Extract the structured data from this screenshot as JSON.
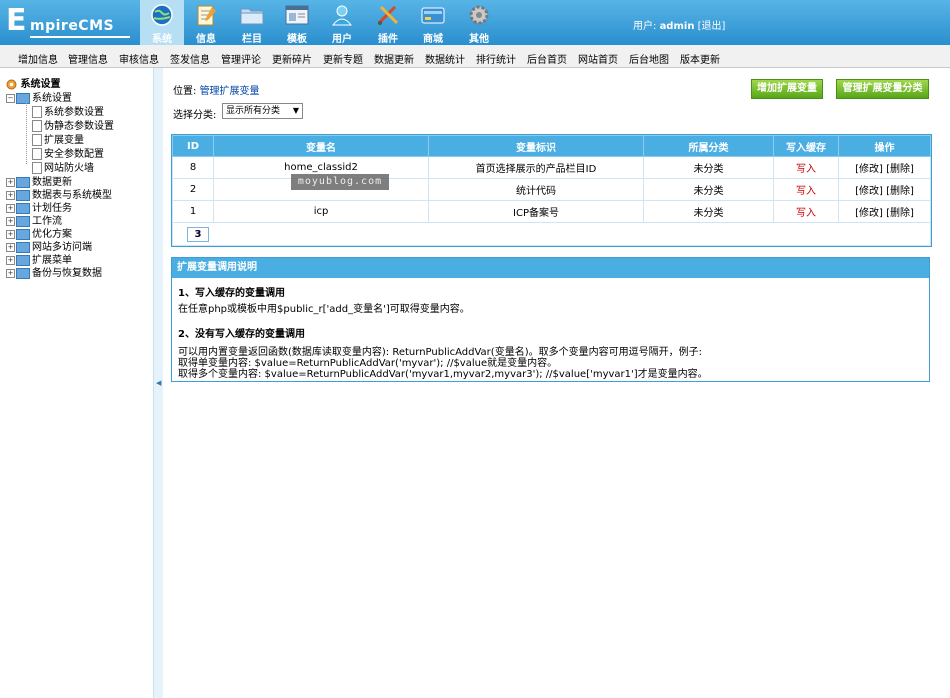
{
  "logo": {
    "initial": "E",
    "rest": "mpireCMS"
  },
  "topnav": [
    {
      "label": "系统",
      "icon": "globe-icon",
      "active": true
    },
    {
      "label": "信息",
      "icon": "notepad-icon",
      "active": false
    },
    {
      "label": "栏目",
      "icon": "folder-icon",
      "active": false
    },
    {
      "label": "模板",
      "icon": "window-icon",
      "active": false
    },
    {
      "label": "用户",
      "icon": "user-icon",
      "active": false
    },
    {
      "label": "插件",
      "icon": "tools-icon",
      "active": false
    },
    {
      "label": "商城",
      "icon": "card-icon",
      "active": false
    },
    {
      "label": "其他",
      "icon": "gear-icon",
      "active": false
    }
  ],
  "user": {
    "prefix": "用户:",
    "name": "admin",
    "logout": "[退出]"
  },
  "menubar": [
    "增加信息",
    "管理信息",
    "审核信息",
    "签发信息",
    "管理评论",
    "更新碎片",
    "更新专题",
    "数据更新",
    "数据统计",
    "排行统计",
    "后台首页",
    "网站首页",
    "后台地图",
    "版本更新"
  ],
  "tree": {
    "root": "系统设置",
    "group": "系统设置",
    "children": [
      "系统参数设置",
      "伪静态参数设置",
      "扩展变量",
      "安全参数配置",
      "网站防火墙"
    ],
    "others": [
      "数据更新",
      "数据表与系统模型",
      "计划任务",
      "工作流",
      "优化方案",
      "网站多访问端",
      "扩展菜单",
      "备份与恢复数据"
    ]
  },
  "location": {
    "prefix": "位置: ",
    "link": "管理扩展变量"
  },
  "buttons": {
    "add": "增加扩展变量",
    "manage_class": "管理扩展变量分类"
  },
  "category": {
    "label": "选择分类:",
    "selected": "显示所有分类"
  },
  "table": {
    "headers": [
      "ID",
      "变量名",
      "变量标识",
      "所属分类",
      "写入缓存",
      "操作"
    ],
    "rows": [
      {
        "id": "8",
        "name": "home_classid2",
        "flag": "首页选择展示的产品栏目ID",
        "class": "未分类",
        "cache": "写入",
        "ops": "[修改] [删除]"
      },
      {
        "id": "2",
        "name": "",
        "flag": "统计代码",
        "class": "未分类",
        "cache": "写入",
        "ops": "[修改] [删除]"
      },
      {
        "id": "1",
        "name": "icp",
        "flag": "ICP备案号",
        "class": "未分类",
        "cache": "写入",
        "ops": "[修改] [删除]"
      }
    ],
    "page": "3"
  },
  "watermark": "moyublog.com",
  "help": {
    "title": "扩展变量调用说明",
    "s1_title": "1、写入缓存的变量调用",
    "s1_text": "在任意php或模板中用$public_r['add_变量名']可取得变量内容。",
    "s2_title": "2、没有写入缓存的变量调用",
    "s2_line1": "可以用内置变量返回函数(数据库读取变量内容): ReturnPublicAddVar(变量名)。取多个变量内容可用逗号隔开，例子:",
    "s2_line2": "取得单变量内容: $value=ReturnPublicAddVar('myvar'); //$value就是变量内容。",
    "s2_line3": "取得多个变量内容: $value=ReturnPublicAddVar('myvar1,myvar2,myvar3'); //$value['myvar1']才是变量内容。"
  },
  "colors": {
    "header": "#2a8fce",
    "table_header": "#4aaee3",
    "button_green": "#58a61b",
    "cache_red": "#c80000"
  }
}
